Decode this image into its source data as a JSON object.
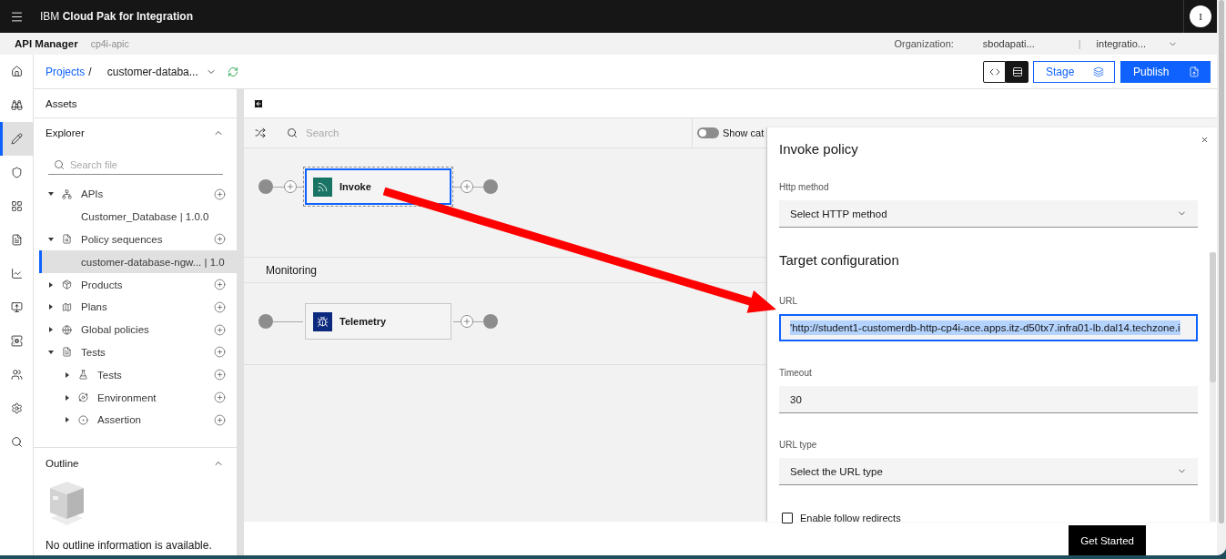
{
  "header": {
    "brand": "IBM **Cloud Pak for Integration**",
    "avatar_initial": "I"
  },
  "subheader": {
    "app_name": "API Manager",
    "instance": "cp4i-apic",
    "organization_label": "Organization:",
    "organization": "sbodapati...",
    "separator": "|",
    "catalog": "integratio..."
  },
  "rail": [
    {
      "selected": false
    },
    {
      "selected": false
    },
    {
      "selected": true
    },
    {
      "selected": false
    },
    {
      "selected": false
    },
    {
      "selected": false
    },
    {
      "selected": false
    },
    {
      "selected": false
    },
    {
      "selected": false
    },
    {
      "selected": false
    },
    {
      "selected": false
    },
    {
      "selected": false
    }
  ],
  "breadcrumb": {
    "link": "Projects",
    "separator": "/",
    "project": "customer-databa..."
  },
  "view_toggle": [
    {
      "selected": false
    },
    {
      "selected": true
    }
  ],
  "actions": [
    {
      "label": "Stage",
      "kind": "secondary"
    },
    {
      "label": "Publish",
      "kind": "primary"
    }
  ],
  "assets": {
    "title": "Assets"
  },
  "explorer": {
    "title": "Explorer",
    "expanded": true,
    "search_placeholder": "Search file",
    "tree": [
      {
        "label": "APIs",
        "selected": false,
        "expanded": true,
        "children": [
          {
            "label": "Customer_Database | 1.0.0",
            "selected": false
          }
        ]
      },
      {
        "label": "Policy sequences",
        "selected": false,
        "expanded": true,
        "children": [
          {
            "label": "customer-database-ngw... | 1.0",
            "selected": true
          }
        ]
      },
      {
        "label": "Products",
        "selected": false,
        "expanded": false
      },
      {
        "label": "Plans",
        "selected": false,
        "expanded": false
      },
      {
        "label": "Global policies",
        "selected": false,
        "expanded": false
      },
      {
        "label": "Tests",
        "selected": false,
        "expanded": true,
        "children": [
          {
            "label": "Tests",
            "selected": false,
            "expanded": false
          },
          {
            "label": "Environment",
            "selected": false,
            "expanded": false
          },
          {
            "label": "Assertion",
            "selected": false,
            "expanded": false
          }
        ]
      }
    ]
  },
  "outline": {
    "title": "Outline",
    "expanded": true,
    "message": "No outline information is available."
  },
  "canvas": {
    "search_placeholder": "Search",
    "show_categories": {
      "label": "Show cat",
      "on": false
    },
    "flows": [
      {
        "nodes": [
          {
            "label": "Invoke",
            "kind": "invoke",
            "selected": true
          }
        ]
      },
      {
        "title": "Monitoring",
        "nodes": [
          {
            "label": "Telemetry",
            "kind": "telemetry",
            "selected": false
          }
        ]
      }
    ]
  },
  "panel": {
    "title": "Invoke policy",
    "fields": [
      {
        "kind": "select",
        "label": "Http method",
        "placeholder": "Select HTTP method"
      },
      {
        "kind": "heading",
        "text": "Target configuration"
      },
      {
        "kind": "text",
        "label": "URL",
        "value": "'http://student1-customerdb-http-cp4i-ace.apps.itz-d50tx7.infra01-lb.dal14.techzone.i",
        "focused": true,
        "text_selected": true
      },
      {
        "kind": "text",
        "label": "Timeout",
        "value": "30",
        "focused": false,
        "text_selected": false
      },
      {
        "kind": "select",
        "label": "URL type",
        "placeholder": "Select the URL type"
      },
      {
        "kind": "checkbox",
        "label": "Enable follow redirects",
        "checked": false
      }
    ]
  },
  "tour_button": {
    "label": "Get Started"
  }
}
